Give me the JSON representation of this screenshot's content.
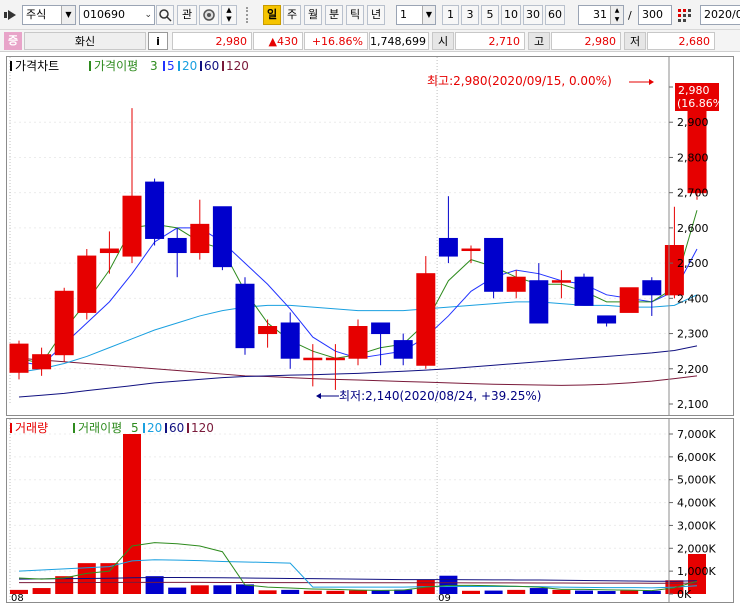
{
  "toolbar": {
    "market": "주식",
    "code": "010690",
    "favorite_label": "관",
    "period_tabs": [
      "일",
      "주",
      "월",
      "분",
      "틱",
      "년"
    ],
    "interval_value": "1",
    "interval_presets": [
      "1",
      "3",
      "5",
      "10",
      "30",
      "60"
    ],
    "count_value": "31",
    "count_sep": "/",
    "total_count": "300",
    "date_value": "2020/0"
  },
  "quote": {
    "badge": "증",
    "name": "화신",
    "info_label": "i",
    "price": "2,980",
    "change": "▲430",
    "change_pct": "+16.86%",
    "volume": "1,748,699",
    "open_label": "시",
    "open": "2,710",
    "high_label": "고",
    "high": "2,980",
    "low_label": "저",
    "low": "2,680"
  },
  "price_panel": {
    "legend": {
      "title": "가격차트",
      "ma_title": "가격이평",
      "ma_periods": [
        "3",
        "5",
        "20",
        "60",
        "120"
      ]
    },
    "high_annotation": "최고:2,980(2020/09/15, 0.00%)",
    "low_annotation": "최저:2,140(2020/08/24, +39.25%)",
    "last_price_tag": "2,980",
    "last_pct_tag": "(16.86%)"
  },
  "volume_panel": {
    "legend": {
      "title": "거래량",
      "ma_title": "거래이평",
      "ma_periods": [
        "5",
        "20",
        "60",
        "120"
      ]
    }
  },
  "x_axis": {
    "month_labels": [
      "08",
      "09"
    ]
  },
  "colors": {
    "up": "#e60000",
    "down": "#0000cc",
    "ma3": "#2e8b1e",
    "ma5": "#2233ff",
    "ma20": "#1aa0e0",
    "ma60": "#101080",
    "ma120": "#7a1a3a"
  },
  "chart_data": [
    {
      "type": "candlestick",
      "ylim": [
        2100,
        3000
      ],
      "yticks": [
        "2,100",
        "2,200",
        "2,300",
        "2,400",
        "2,500",
        "2,600",
        "2,700",
        "2,800",
        "2,900",
        "3,000"
      ],
      "candles": [
        {
          "o": 2190,
          "h": 2280,
          "l": 2170,
          "c": 2270
        },
        {
          "o": 2200,
          "h": 2260,
          "l": 2180,
          "c": 2240
        },
        {
          "o": 2240,
          "h": 2430,
          "l": 2220,
          "c": 2420
        },
        {
          "o": 2360,
          "h": 2540,
          "l": 2340,
          "c": 2520
        },
        {
          "o": 2530,
          "h": 2590,
          "l": 2470,
          "c": 2540
        },
        {
          "o": 2520,
          "h": 2940,
          "l": 2500,
          "c": 2690
        },
        {
          "o": 2730,
          "h": 2740,
          "l": 2550,
          "c": 2570
        },
        {
          "o": 2570,
          "h": 2600,
          "l": 2460,
          "c": 2530
        },
        {
          "o": 2530,
          "h": 2680,
          "l": 2510,
          "c": 2610
        },
        {
          "o": 2660,
          "h": 2660,
          "l": 2480,
          "c": 2490
        },
        {
          "o": 2440,
          "h": 2460,
          "l": 2240,
          "c": 2260
        },
        {
          "o": 2300,
          "h": 2340,
          "l": 2260,
          "c": 2320
        },
        {
          "o": 2330,
          "h": 2360,
          "l": 2200,
          "c": 2230
        },
        {
          "o": 2230,
          "h": 2270,
          "l": 2150,
          "c": 2230
        },
        {
          "o": 2230,
          "h": 2270,
          "l": 2140,
          "c": 2230
        },
        {
          "o": 2230,
          "h": 2340,
          "l": 2210,
          "c": 2320
        },
        {
          "o": 2330,
          "h": 2330,
          "l": 2210,
          "c": 2300
        },
        {
          "o": 2280,
          "h": 2300,
          "l": 2210,
          "c": 2230
        },
        {
          "o": 2210,
          "h": 2520,
          "l": 2200,
          "c": 2470
        },
        {
          "o": 2570,
          "h": 2690,
          "l": 2500,
          "c": 2520
        },
        {
          "o": 2540,
          "h": 2550,
          "l": 2500,
          "c": 2540
        },
        {
          "o": 2570,
          "h": 2570,
          "l": 2400,
          "c": 2420
        },
        {
          "o": 2420,
          "h": 2480,
          "l": 2400,
          "c": 2460
        },
        {
          "o": 2450,
          "h": 2500,
          "l": 2330,
          "c": 2330
        },
        {
          "o": 2450,
          "h": 2480,
          "l": 2400,
          "c": 2450
        },
        {
          "o": 2460,
          "h": 2470,
          "l": 2380,
          "c": 2380
        },
        {
          "o": 2350,
          "h": 2350,
          "l": 2320,
          "c": 2330
        },
        {
          "o": 2360,
          "h": 2430,
          "l": 2360,
          "c": 2430
        },
        {
          "o": 2450,
          "h": 2460,
          "l": 2350,
          "c": 2410
        },
        {
          "o": 2410,
          "h": 2660,
          "l": 2400,
          "c": 2550
        },
        {
          "o": 2700,
          "h": 2980,
          "l": 2680,
          "c": 2980
        }
      ],
      "ma3": [
        2230,
        2215,
        2310,
        2390,
        2480,
        2600,
        2610,
        2600,
        2560,
        2540,
        2420,
        2330,
        2280,
        2250,
        2230,
        2240,
        2260,
        2270,
        2330,
        2450,
        2510,
        2490,
        2460,
        2440,
        2440,
        2420,
        2390,
        2390,
        2390,
        2430,
        2650
      ],
      "ma5": [
        2220,
        2210,
        2270,
        2330,
        2390,
        2470,
        2560,
        2600,
        2600,
        2560,
        2500,
        2440,
        2370,
        2290,
        2250,
        2230,
        2240,
        2250,
        2290,
        2350,
        2420,
        2460,
        2480,
        2470,
        2450,
        2440,
        2410,
        2400,
        2390,
        2420,
        2540
      ],
      "ma20": [
        2190,
        2200,
        2215,
        2235,
        2260,
        2285,
        2310,
        2330,
        2350,
        2365,
        2375,
        2380,
        2380,
        2375,
        2370,
        2365,
        2365,
        2365,
        2370,
        2375,
        2380,
        2385,
        2390,
        2390,
        2385,
        2380,
        2380,
        2375,
        2375,
        2380,
        2410
      ],
      "ma60": [
        2120,
        2125,
        2130,
        2138,
        2145,
        2152,
        2160,
        2165,
        2170,
        2175,
        2178,
        2180,
        2182,
        2183,
        2185,
        2187,
        2190,
        2193,
        2196,
        2200,
        2205,
        2210,
        2215,
        2220,
        2225,
        2230,
        2235,
        2240,
        2245,
        2252,
        2265
      ],
      "ma120": [
        2230,
        2225,
        2220,
        2215,
        2210,
        2205,
        2200,
        2195,
        2190,
        2185,
        2180,
        2178,
        2175,
        2172,
        2170,
        2168,
        2166,
        2164,
        2162,
        2160,
        2158,
        2156,
        2155,
        2154,
        2153,
        2154,
        2156,
        2160,
        2165,
        2172,
        2180
      ]
    },
    {
      "type": "bar",
      "ylim": [
        0,
        7000
      ],
      "yticks": [
        "0K",
        "1,000K",
        "2,000K",
        "3,000K",
        "4,000K",
        "5,000K",
        "6,000K",
        "7,000K"
      ],
      "volumes": [
        180,
        260,
        780,
        1350,
        1350,
        7000,
        780,
        280,
        380,
        380,
        420,
        160,
        180,
        140,
        140,
        160,
        150,
        190,
        620,
        800,
        140,
        150,
        180,
        260,
        180,
        150,
        130,
        150,
        140,
        600,
        1750
      ],
      "ma5": [
        700,
        650,
        700,
        900,
        1000,
        2100,
        2250,
        2200,
        2100,
        1850,
        400,
        300,
        260,
        220,
        200,
        170,
        160,
        170,
        300,
        380,
        380,
        360,
        340,
        300,
        200,
        200,
        180,
        170,
        150,
        270,
        560
      ],
      "ma20": [
        1000,
        1050,
        1100,
        1150,
        1200,
        1450,
        1500,
        1480,
        1460,
        1420,
        1400,
        1380,
        1350,
        300,
        300,
        300,
        300,
        300,
        320,
        330,
        330,
        330,
        330,
        320,
        300,
        290,
        280,
        280,
        270,
        300,
        360
      ],
      "ma60": [
        650,
        660,
        670,
        680,
        690,
        710,
        720,
        720,
        715,
        710,
        700,
        690,
        680,
        670,
        660,
        650,
        640,
        630,
        630,
        630,
        625,
        620,
        615,
        610,
        600,
        590,
        580,
        570,
        560,
        560,
        580
      ],
      "ma120": [
        500,
        500,
        500,
        505,
        505,
        510,
        510,
        510,
        510,
        505,
        505,
        500,
        500,
        495,
        495,
        490,
        490,
        490,
        490,
        490,
        488,
        486,
        484,
        482,
        480,
        478,
        476,
        474,
        472,
        470,
        475
      ]
    }
  ]
}
